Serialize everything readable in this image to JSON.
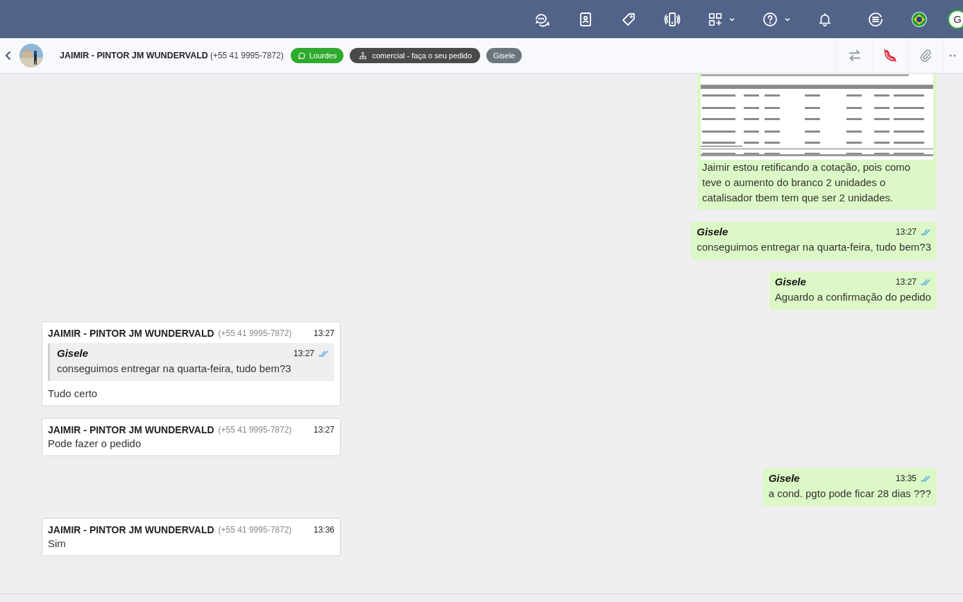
{
  "top_bar": {
    "avatar_initial": "G"
  },
  "chat_header": {
    "contact_name": "JAIMIR - PINTOR JM WUNDERVALD",
    "contact_phone": "(+55 41 9995-7872)",
    "tags": [
      {
        "kind": "whatsapp",
        "label": "Lourdes",
        "color": "#2eaa2e"
      },
      {
        "kind": "department",
        "label": "comercial - faça o seu pedido",
        "color": "#4a4a4a"
      },
      {
        "kind": "agent",
        "label": "Gisele",
        "color": "#6c757d"
      }
    ]
  },
  "messages": [
    {
      "kind": "outgoing",
      "attachment": {
        "kind": "document"
      },
      "text": "Jaimir estou retificando a cotação, pois como teve o aumento do branco 2 unidades o catalisador tbem tem que ser 2 unidades."
    },
    {
      "kind": "outgoing",
      "sender": "Gisele",
      "time": "13:27",
      "read": true,
      "text": "conseguimos entregar na quarta-feira, tudo bem?3"
    },
    {
      "kind": "outgoing",
      "sender": "Gisele",
      "time": "13:27",
      "read": true,
      "text": "Aguardo a confirmação do pedido"
    },
    {
      "kind": "incoming",
      "sender": "JAIMIR - PINTOR JM WUNDERVALD",
      "phone": "(+55 41 9995-7872)",
      "time": "13:27",
      "quote": {
        "sender": "Gisele",
        "time": "13:27",
        "read": true,
        "text": "conseguimos entregar na quarta-feira, tudo bem?3"
      },
      "text": "Tudo certo"
    },
    {
      "kind": "incoming",
      "sender": "JAIMIR - PINTOR JM WUNDERVALD",
      "phone": "(+55 41 9995-7872)",
      "time": "13:27",
      "text": "Pode fazer o pedido"
    },
    {
      "kind": "outgoing",
      "sender": "Gisele",
      "time": "13:35",
      "read": true,
      "text": "a cond. pgto pode ficar 28 dias ???"
    },
    {
      "kind": "incoming",
      "sender": "JAIMIR - PINTOR JM WUNDERVALD",
      "phone": "(+55 41 9995-7872)",
      "time": "13:36",
      "text": "Sim"
    }
  ]
}
